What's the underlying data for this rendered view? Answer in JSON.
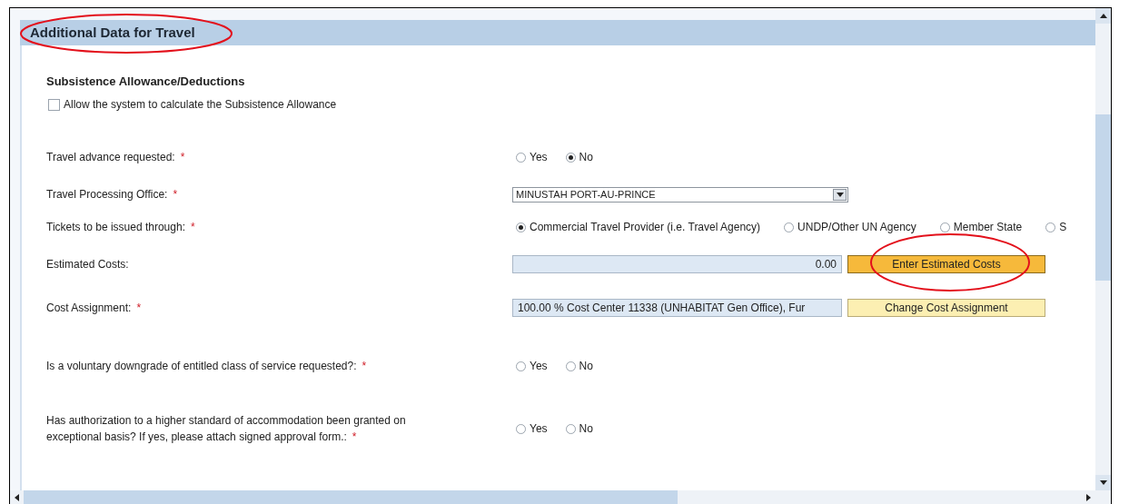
{
  "header": {
    "title": "Additional Data for Travel"
  },
  "subsistence": {
    "heading": "Subsistence Allowance/Deductions",
    "checkbox": {
      "label": "Allow the system to calculate the Subsistence Allowance",
      "checked": false
    }
  },
  "fields": [
    {
      "kind": "radio",
      "label": "Travel advance requested:",
      "required_mark": "*",
      "options": [
        {
          "label": "Yes",
          "selected": false
        },
        {
          "label": "No",
          "selected": true
        }
      ]
    },
    {
      "kind": "dropdown",
      "label": "Travel Processing Office:",
      "required_mark": "*",
      "value": "MINUSTAH PORT-AU-PRINCE"
    },
    {
      "kind": "radio",
      "label": "Tickets to be issued through:",
      "required_mark": "*",
      "options": [
        {
          "label": "Commercial Travel Provider (i.e. Travel Agency)",
          "selected": true
        },
        {
          "label": "UNDP/Other UN Agency",
          "selected": false
        },
        {
          "label": "Member State",
          "selected": false
        },
        {
          "label": "S",
          "selected": false
        }
      ]
    },
    {
      "kind": "amount",
      "label": "Estimated Costs:",
      "value": "0.00",
      "button": {
        "label": "Enter Estimated Costs",
        "emphasized": true
      }
    },
    {
      "kind": "text",
      "label": "Cost Assignment:",
      "required_mark": "*",
      "value": "100.00 % Cost Center 11338 (UNHABITAT Gen Office), Fur",
      "button": {
        "label": "Change Cost Assignment",
        "emphasized": false
      }
    },
    {
      "kind": "radio",
      "label": "Is a voluntary downgrade of entitled class of service requested?:",
      "required_mark": "*",
      "options": [
        {
          "label": "Yes",
          "selected": false
        },
        {
          "label": "No",
          "selected": false
        }
      ]
    },
    {
      "kind": "radio",
      "label": "Has authorization to a higher standard of accommodation been granted on exceptional basis? If yes, please attach signed approval form.:",
      "required_mark": "*",
      "options": [
        {
          "label": "Yes",
          "selected": false
        },
        {
          "label": "No",
          "selected": false
        }
      ]
    }
  ]
}
